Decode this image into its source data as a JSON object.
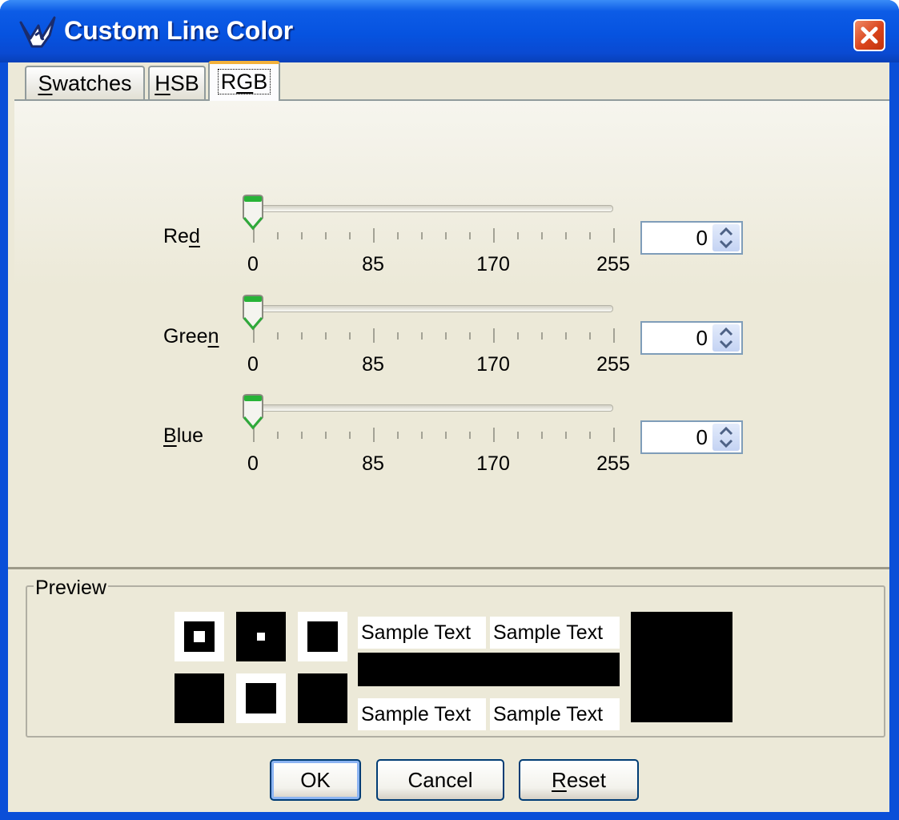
{
  "window": {
    "title": "Custom Line Color",
    "icon": "app-logo-icon",
    "close_icon": "close-icon"
  },
  "tabs": [
    {
      "label": "Swatches",
      "mnemonic": "S",
      "active": false
    },
    {
      "label": "HSB",
      "mnemonic": "H",
      "active": false
    },
    {
      "label": "RGB",
      "mnemonic": "G",
      "active": true
    }
  ],
  "rgb": {
    "channels": [
      {
        "pre": "Re",
        "key": "d",
        "post": "",
        "value": "0",
        "ticks": [
          "0",
          "85",
          "170",
          "255"
        ],
        "level": 0
      },
      {
        "pre": "Gree",
        "key": "n",
        "post": "",
        "value": "0",
        "ticks": [
          "0",
          "85",
          "170",
          "255"
        ],
        "level": 0
      },
      {
        "pre": "",
        "key": "B",
        "post": "lue",
        "value": "0",
        "ticks": [
          "0",
          "85",
          "170",
          "255"
        ],
        "level": 0
      }
    ]
  },
  "preview": {
    "title": "Preview",
    "sample_text": "Sample Text",
    "color": "#000000"
  },
  "buttons": {
    "ok": "OK",
    "cancel": "Cancel",
    "reset_key": "R",
    "reset_rest": "eset"
  },
  "colors": {
    "titlebar": "#0653e0",
    "panel": "#ece9d8",
    "tab_highlight": "#f3b13b",
    "button_border": "#003c74"
  }
}
